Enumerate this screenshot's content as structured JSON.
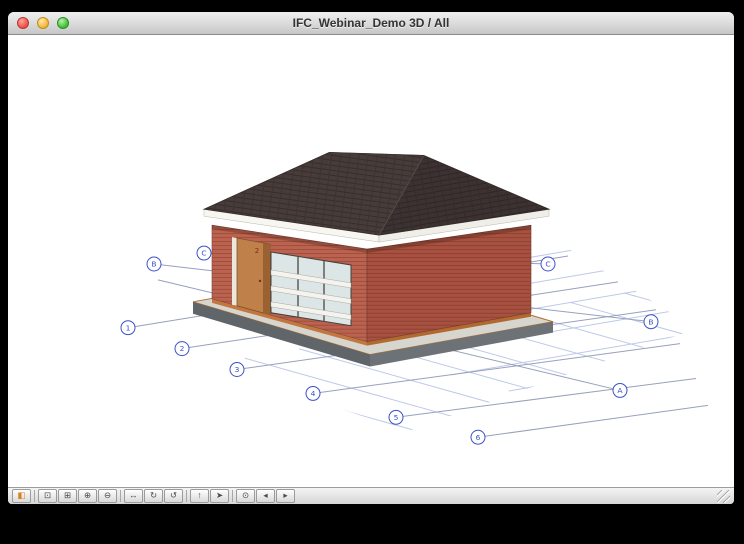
{
  "window": {
    "title": "IFC_Webinar_Demo 3D / All"
  },
  "scene": {
    "door_label": "2",
    "grid_axes": {
      "numbers": [
        {
          "label": "1",
          "bubble": [
            120,
            294
          ],
          "line_to": [
            560,
            222
          ]
        },
        {
          "label": "2",
          "bubble": [
            174,
            315
          ],
          "line_to": [
            610,
            248
          ]
        },
        {
          "label": "3",
          "bubble": [
            229,
            336
          ],
          "line_to": [
            648,
            276
          ]
        },
        {
          "label": "4",
          "bubble": [
            305,
            360
          ],
          "line_to": [
            672,
            310
          ]
        },
        {
          "label": "5",
          "bubble": [
            388,
            384
          ],
          "line_to": [
            688,
            345
          ]
        },
        {
          "label": "6",
          "bubble": [
            470,
            404
          ],
          "line_to": [
            700,
            372
          ]
        }
      ],
      "letters": [
        {
          "label": "A",
          "bubble": [
            612,
            357
          ],
          "line_to": [
            150,
            246
          ]
        },
        {
          "label": "B",
          "bubble": [
            643,
            288
          ],
          "line_to": [
            146,
            230
          ],
          "bubble2": [
            146,
            230
          ]
        },
        {
          "label": "C",
          "bubble": [
            540,
            230
          ],
          "line_to": [
            196,
            219
          ],
          "bubble2": [
            196,
            219
          ]
        }
      ]
    },
    "colors": {
      "wall_front": "#bb6350",
      "wall_right": "#a85140",
      "roof": "#43393a",
      "fascia": "#f7f6f1",
      "slab_side": "#60656a",
      "slab_top": "#d6d6cf",
      "terrain_edge": "#c3763f",
      "door": "#c08049",
      "glass": "#dde6e6",
      "grid_line": "#bdc9e8",
      "axis_blue": "#3a50c8"
    }
  },
  "toolbar": {
    "tools": [
      {
        "name": "view-mode-tool",
        "glyph": "◧",
        "accent": true
      },
      {
        "name": "fit-in-window-tool",
        "glyph": "⊡"
      },
      {
        "name": "zoom-window-tool",
        "glyph": "⊞"
      },
      {
        "name": "zoom-in-tool",
        "glyph": "⊕"
      },
      {
        "name": "zoom-out-tool",
        "glyph": "⊖"
      },
      {
        "name": "pan-tool",
        "glyph": "↔"
      },
      {
        "name": "rotate-view-tool",
        "glyph": "↻"
      },
      {
        "name": "orbit-tool",
        "glyph": "↺"
      },
      {
        "name": "walk-tool",
        "glyph": "↑"
      },
      {
        "name": "select-arrow-tool",
        "glyph": "➤"
      },
      {
        "name": "look-to-tool",
        "glyph": "⊙"
      },
      {
        "name": "previous-view-tool",
        "glyph": "◂"
      },
      {
        "name": "next-view-tool",
        "glyph": "▸"
      }
    ]
  }
}
